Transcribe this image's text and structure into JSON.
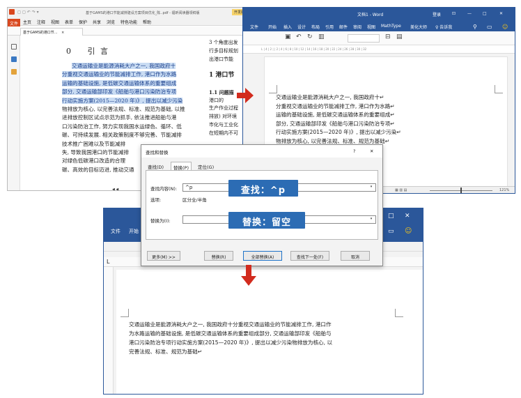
{
  "pdf": {
    "title": "基于GAMS的港口节能减排建设方案项目优化_陈..pdf - 福昕阅读器领鲜版",
    "topbtn": "开发版",
    "menu": [
      "文件",
      "主页",
      "注释",
      "视图",
      "表单",
      "保护",
      "共享",
      "浏览",
      "特色功能",
      "帮助"
    ],
    "doctab": "基于GAMS的港口节...",
    "doctab_close": "×",
    "heading_num": "0",
    "heading_text": "引 言",
    "para_highlight_lines": [
      "交通运输业是能源消耗大户之一, 我国政府十",
      "分重视交通运输业的节能减排工作, 港口作为水路",
      "运输的基础设施, 是低碳交通运输体系的重要组成",
      "部分, 交通运输部印发《船舶与港口污染防治专项",
      "行动实施方案(2015—2020 年)》, 提出以减少污染"
    ],
    "para_plain_lines": [
      "物排放为核心, 以完善法规、标准、规范为基础, 以推",
      "进排放控制区试点示范为抓手, 依法推进船舶与港",
      "口污染防治工作, 努力实现我国水运绿色、循环、低",
      "碳、可持续发展. 相关政策制度不够完善、节能减排",
      "技术推广困难以及节能减排",
      "失, 导致我国港口的节能减排",
      "对绿色低碳港口改造的合理",
      "碳、高效的目标迈进, 推动交通"
    ],
    "pager": "◀  ◀",
    "right_col": [
      "3 个角度出发",
      "行多目标规划",
      "出港口节能",
      "",
      "1  港口节",
      "",
      "1.1  问题描",
      "      港口的",
      "生产作业过程",
      "排放) 对环境",
      "市化与工业化",
      "在短期内不可"
    ]
  },
  "word_top": {
    "title": "文档1 - Word",
    "title_right": "登录",
    "window_controls": [
      "—",
      "□",
      "✕"
    ],
    "ribbon_tabs": [
      "文件",
      "开始",
      "插入",
      "设计",
      "布局",
      "引用",
      "邮件",
      "审阅",
      "视图",
      "MathType",
      "美化大师",
      "♀ 告诉我"
    ],
    "ruler_ticks": "L  | 4 | 2 |   | 2 | 4 | 6 | 8 | 10 | 12 | 14 | 16 | 18 | 20 | 22 | 24 | 26 | 28 | 30 | 32",
    "body_lines": [
      "交通运输业是能源消耗大户之一, 我国政府十↵",
      "分重视交通运输业的节能减排工作, 港口作为水路↵",
      "运输的基础设施, 是低碳交通运输体系的重要组成↵",
      "部分, 交通运输部印发《船舶与港口污染防治专项↵",
      "行动实施方案(2015—2020 年)》, 提出以减少污染↵",
      "物排放为核心, 以完善法规、标准、规范为基础↵"
    ],
    "zoom": "121%"
  },
  "dialog": {
    "title": "查找和替换",
    "help": "?",
    "close": "✕",
    "tabs": [
      "查找(D)",
      "替换(P)",
      "定位(G)"
    ],
    "find_label": "查找内容(N):",
    "find_value": "^p",
    "options_label": "选项:",
    "options_value": "区分全/半角",
    "replace_label": "替换为(I):",
    "replace_value": "",
    "buttons": {
      "more": "更多(M) >>",
      "replace": "替换(R)",
      "replace_all": "全部替换(A)",
      "find_next": "查找下一处(F)",
      "cancel": "取消"
    }
  },
  "callouts": {
    "find": "查找：^p",
    "replace": "替换：留空"
  },
  "word_bottom": {
    "tabs": [
      "文件",
      "开始"
    ],
    "window_controls": [
      "□",
      "✕"
    ],
    "body_lines": [
      "交通运输业是能源消耗大户之一, 我国政府十分重视交通运输业的节能减排工作, 港口作",
      "为水路运输的基础设施, 是低碳交通运输体系的重要组成部分, 交通运输部印发《船舶与",
      "港口污染防治专项行动实施方案(2015—2020 年)》, 提出以减少污染物排放为核心, 以",
      "完善法规、标准、规范为基础↵"
    ]
  },
  "colors": {
    "word_blue": "#2b579a",
    "highlight": "#c9dcf3",
    "callout_blue": "#2c6cb4",
    "arrow_red": "#d22b1e",
    "pdf_orange": "#d9481f"
  }
}
